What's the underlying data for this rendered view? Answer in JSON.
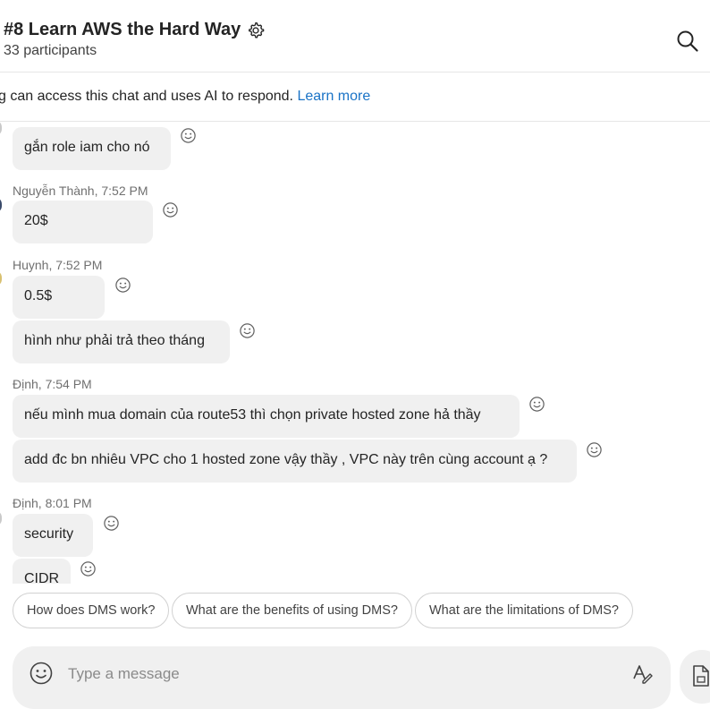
{
  "header": {
    "title": "#8 Learn AWS the Hard Way",
    "participants": "33 participants"
  },
  "banner": {
    "text": "g can access this chat and uses AI to respond.",
    "link": "Learn more"
  },
  "messages": [
    {
      "text": "gắn role iam cho nó"
    },
    {
      "sender": "Nguyễn Thành, 7:52 PM",
      "text": "20$"
    },
    {
      "sender": "Huynh, 7:52 PM",
      "text": "0.5$"
    },
    {
      "text": "hình như phải trả theo tháng"
    },
    {
      "sender": "Định, 7:54 PM",
      "text": "nếu mình mua domain của route53 thì chọn private hosted zone hả thầy"
    },
    {
      "text": "add đc bn nhiêu VPC cho 1 hosted zone vậy thầy , VPC này trên cùng account ạ ?"
    },
    {
      "sender": "Định, 8:01 PM",
      "text": "security"
    },
    {
      "text": "CIDR"
    }
  ],
  "suggestions": [
    "How does DMS work?",
    "What are the benefits of using DMS?",
    "What are the limitations of DMS?"
  ],
  "composer": {
    "placeholder": "Type a message"
  },
  "icons": {
    "settings": "gear-icon",
    "search": "search-icon",
    "reaction": "smiley-icon",
    "emoji": "emoji-icon",
    "format": "text-format-icon",
    "attach": "attach-file-icon"
  },
  "colors": {
    "link": "#1a73c6",
    "bubble": "#f0f0f0",
    "chip_border": "#d1d1d1"
  }
}
